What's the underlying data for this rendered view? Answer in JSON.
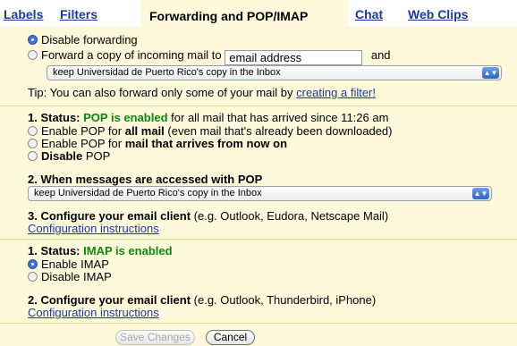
{
  "tabs": [
    {
      "label": "Labels"
    },
    {
      "label": "Filters"
    },
    {
      "label": "Forwarding and POP/IMAP"
    },
    {
      "label": "Chat"
    },
    {
      "label": "Web Clips"
    }
  ],
  "forwarding": {
    "disable_label": "Disable forwarding",
    "forward_label_pre": "Forward a copy of incoming mail to",
    "email_value": "email address",
    "and_label": "and",
    "copy_select": "keep Universidad de Puerto Rico's copy in the Inbox",
    "tip_text": "Tip: You can also forward only some of your mail by ",
    "tip_link": "creating a filter!"
  },
  "pop": {
    "status_label": "1. Status: ",
    "status_value": "POP is enabled",
    "status_suffix": " for all mail that has arrived since 11:26 am",
    "opt1_pre": "Enable POP for ",
    "opt1_bold": "all mail",
    "opt1_post": " (even mail that's already been downloaded)",
    "opt2_pre": "Enable POP for ",
    "opt2_bold": "mail that arrives from now on",
    "opt3_bold": "Disable",
    "opt3_post": " POP",
    "when_label": "2. When messages are accessed with POP",
    "when_select": "keep Universidad de Puerto Rico's copy in the Inbox",
    "config_bold": "3. Configure your email client",
    "config_rest": " (e.g. Outlook, Eudora, Netscape Mail)",
    "config_link": "Configuration instructions"
  },
  "imap": {
    "status_label": "1. Status: ",
    "status_value": "IMAP is enabled",
    "enable_label": "Enable IMAP",
    "disable_label": "Disable IMAP",
    "config_bold": "2. Configure your email client",
    "config_rest": " (e.g. Outlook, Thunderbird, iPhone)",
    "config_link": "Configuration instructions"
  },
  "buttons": {
    "save": "Save Changes",
    "cancel": "Cancel"
  },
  "colors": {
    "panel_bg": "#fff9dc",
    "link": "#1c38a8",
    "status_green": "#0a8a0a",
    "divider": "#f0d98a"
  },
  "icons": {
    "select_arrow": "updown-arrows-icon",
    "radio": "radio-icon"
  }
}
